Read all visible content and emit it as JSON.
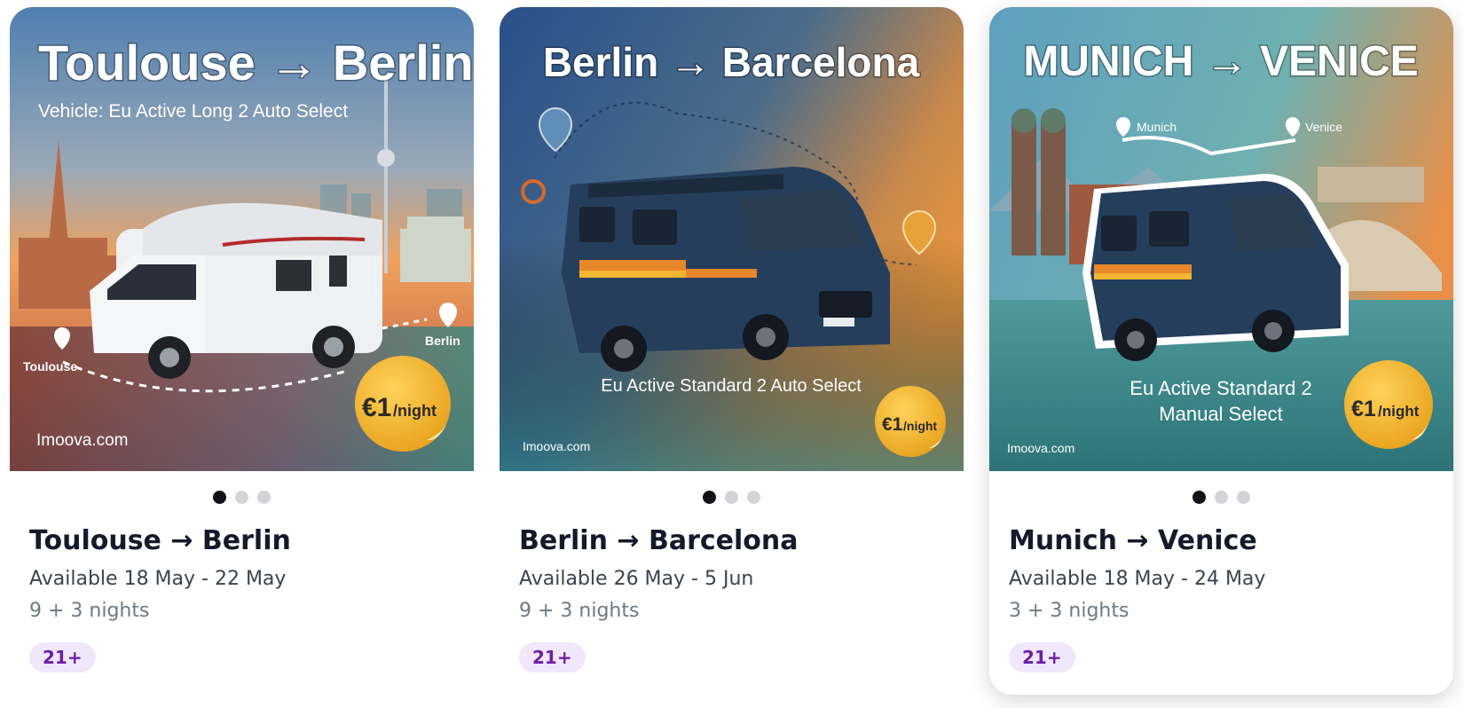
{
  "listings": [
    {
      "title": "Toulouse → Berlin",
      "available": "Available 18 May - 22 May",
      "nights": "9 + 3 nights",
      "badge": "21+",
      "image": {
        "headline": "Toulouse → Berlin",
        "vehicle_line": "Vehicle: Eu Active Long 2 Auto Select",
        "pin_from": "Toulouse",
        "pin_to": "Berlin",
        "brand": "Imoova.com",
        "price_main": "€1",
        "price_unit": "/night"
      },
      "carousel": {
        "count": 3,
        "active": 0
      }
    },
    {
      "title": "Berlin → Barcelona",
      "available": "Available 26 May - 5 Jun",
      "nights": "9 + 3 nights",
      "badge": "21+",
      "image": {
        "headline": "Berlin → Barcelona",
        "vehicle_line": "Eu Active Standard 2 Auto Select",
        "brand": "Imoova.com",
        "price_main": "€1",
        "price_unit": "/night"
      },
      "carousel": {
        "count": 3,
        "active": 0
      }
    },
    {
      "title": "Munich → Venice",
      "available": "Available 18 May - 24 May",
      "nights": "3 + 3 nights",
      "badge": "21+",
      "image": {
        "headline": "MUNICH → VENICE",
        "vehicle_line_1": "Eu Active Standard 2",
        "vehicle_line_2": "Manual Select",
        "pin_from": "Munich",
        "pin_to": "Venice",
        "brand": "Imoova.com",
        "price_main": "€1",
        "price_unit": "/night"
      },
      "carousel": {
        "count": 3,
        "active": 0
      }
    }
  ],
  "colors": {
    "badge_bg": "#f1e7fb",
    "badge_text": "#6b1fa8",
    "sticker": "#f2b632",
    "dot_active": "#111318",
    "dot_inactive": "#d4d4d8"
  }
}
